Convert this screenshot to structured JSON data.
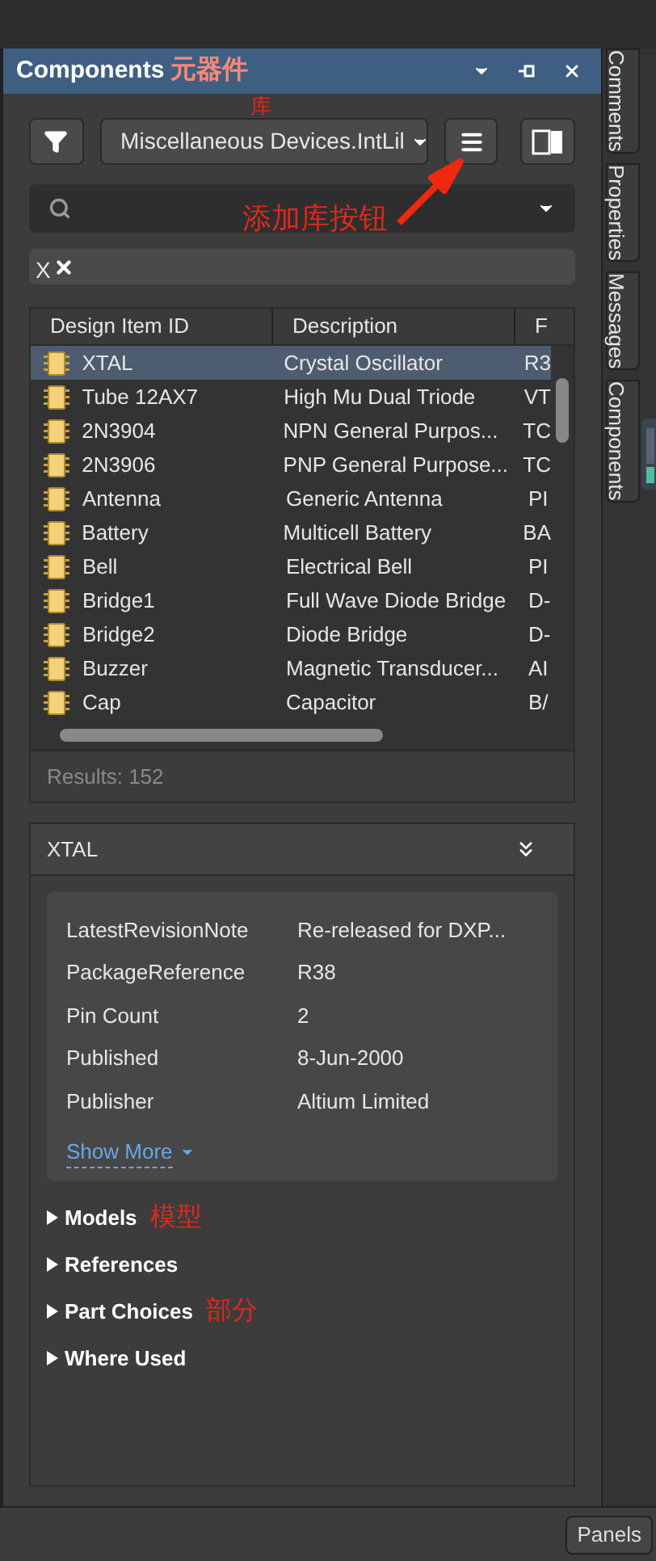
{
  "panel": {
    "title": "Components",
    "title_note": "元器件",
    "library": "Miscellaneous Devices.IntLil",
    "library_note": "库",
    "add_library_note": "添加库按钮",
    "filter_chip": "X"
  },
  "side_tabs": [
    {
      "label": "Comments"
    },
    {
      "label": "Properties"
    },
    {
      "label": "Messages"
    },
    {
      "label": "Components"
    }
  ],
  "table": {
    "columns": [
      "Design Item ID",
      "Description",
      "F"
    ],
    "rows": [
      {
        "cells": [
          "XTAL",
          "Crystal Oscillator",
          "R3"
        ],
        "selected": true
      },
      {
        "cells": [
          "Tube 12AX7",
          "High Mu Dual Triode",
          "VT"
        ],
        "selected": false
      },
      {
        "cells": [
          "2N3904",
          "NPN General Purpos...",
          "TC"
        ],
        "selected": false
      },
      {
        "cells": [
          "2N3906",
          "PNP General Purpose...",
          "TC"
        ],
        "selected": false
      },
      {
        "cells": [
          "Antenna",
          "Generic Antenna",
          "PI"
        ],
        "selected": false
      },
      {
        "cells": [
          "Battery",
          "Multicell Battery",
          "BA"
        ],
        "selected": false
      },
      {
        "cells": [
          "Bell",
          "Electrical Bell",
          "PI"
        ],
        "selected": false
      },
      {
        "cells": [
          "Bridge1",
          "Full Wave Diode Bridge",
          "D-"
        ],
        "selected": false
      },
      {
        "cells": [
          "Bridge2",
          "Diode Bridge",
          "D-"
        ],
        "selected": false
      },
      {
        "cells": [
          "Buzzer",
          "Magnetic Transducer...",
          "AI"
        ],
        "selected": false
      },
      {
        "cells": [
          "Cap",
          "Capacitor",
          "B/"
        ],
        "selected": false
      }
    ]
  },
  "results": "Results: 152",
  "details": {
    "title": "XTAL",
    "properties": [
      {
        "name": "LatestRevisionNote",
        "value": "Re-released for DXP..."
      },
      {
        "name": "PackageReference",
        "value": "R38"
      },
      {
        "name": "Pin Count",
        "value": "2"
      },
      {
        "name": "Published",
        "value": "8-Jun-2000"
      },
      {
        "name": "Publisher",
        "value": "Altium Limited"
      }
    ],
    "show_more": "Show More",
    "sections": [
      {
        "label": "Models",
        "note": "模型",
        "expanded": false
      },
      {
        "label": "References",
        "expanded": false
      },
      {
        "label": "Part Choices",
        "note": "部分",
        "expanded": false
      },
      {
        "label": "Where Used",
        "expanded": false
      }
    ]
  },
  "panels_button": "Panels"
}
